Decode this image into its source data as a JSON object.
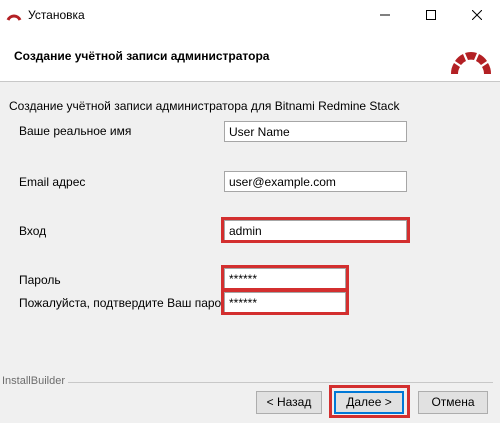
{
  "window": {
    "title": "Установка",
    "minimize_icon": "minimize-icon",
    "maximize_icon": "maximize-icon",
    "close_icon": "close-icon"
  },
  "header": {
    "title": "Создание учётной записи администратора",
    "logo_icon": "redmine-logo-icon",
    "accent_color": "#b32024"
  },
  "main": {
    "subtitle": "Создание учётной записи администратора для Bitnami Redmine Stack",
    "fields": {
      "real_name": {
        "label": "Ваше реальное имя",
        "value": "User Name"
      },
      "email": {
        "label": "Email адрес",
        "value": "user@example.com"
      },
      "login": {
        "label": "Вход",
        "value": "admin"
      },
      "password": {
        "label": "Пароль",
        "value": "******"
      },
      "password_confirm": {
        "label": "Пожалуйста, подтвердите Ваш пароль",
        "value": "******"
      }
    },
    "highlight_color": "#d32f2f"
  },
  "footer": {
    "brand": "InstallBuilder",
    "back_label": "< Назад",
    "next_label": "Далее >",
    "cancel_label": "Отмена"
  }
}
